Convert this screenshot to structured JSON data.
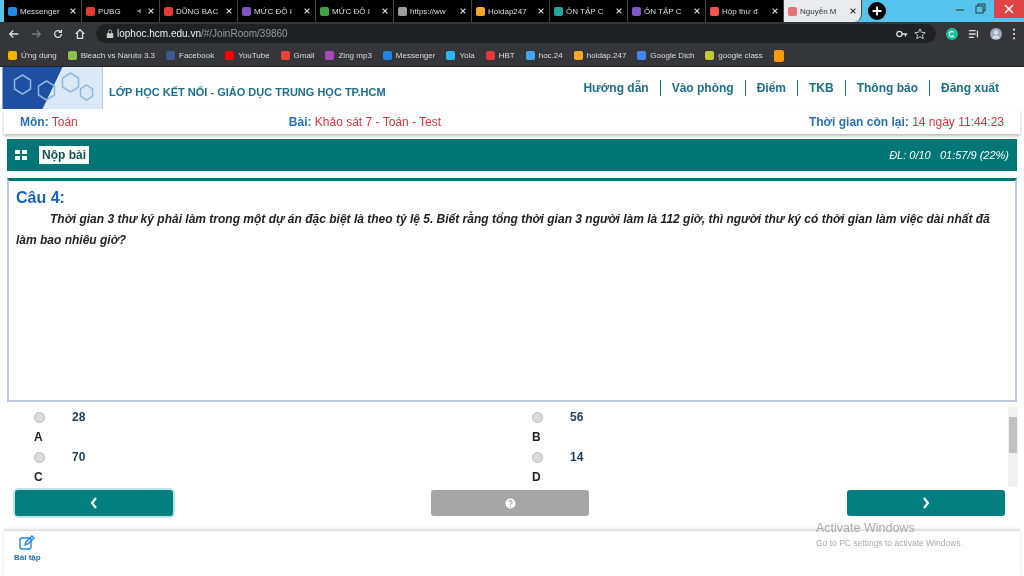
{
  "browser": {
    "tabs": [
      {
        "label": "Messenger",
        "color": "#1e88e5",
        "selected": false,
        "audio": false
      },
      {
        "label": "PUBG",
        "color": "#e53935",
        "selected": false,
        "audio": true
      },
      {
        "label": "DŨNG BAC",
        "color": "#e53935",
        "selected": false,
        "audio": false
      },
      {
        "label": "MỨC ĐỘ I",
        "color": "#7e57c2",
        "selected": false,
        "audio": false
      },
      {
        "label": "MỨC ĐỘ I",
        "color": "#43a047",
        "selected": false,
        "audio": false
      },
      {
        "label": "https://ww",
        "color": "#9e9e9e",
        "selected": false,
        "audio": false
      },
      {
        "label": "Hoidap247",
        "color": "#f9a825",
        "selected": false,
        "audio": false
      },
      {
        "label": "ÔN TẬP C",
        "color": "#26a69a",
        "selected": false,
        "audio": false
      },
      {
        "label": "ÔN TẬP C",
        "color": "#7e57c2",
        "selected": false,
        "audio": false
      },
      {
        "label": "Hộp thư đ",
        "color": "#ef5350",
        "selected": false,
        "audio": false
      },
      {
        "label": "Nguyễn M",
        "color": "#e57373",
        "selected": true,
        "audio": false
      }
    ],
    "url_host": "lophoc.hcm.edu.vn",
    "url_path": "/#/JoinRoom/39860",
    "bookmarks": [
      {
        "label": "Ứng dụng",
        "color": "#f4b400"
      },
      {
        "label": "Bleach vs Naruto 3.3",
        "color": "#8bc34a"
      },
      {
        "label": "Facebook",
        "color": "#3b5998"
      },
      {
        "label": "YouTube",
        "color": "#ff0000"
      },
      {
        "label": "Gmail",
        "color": "#ea4335"
      },
      {
        "label": "Zing mp3",
        "color": "#ab47bc"
      },
      {
        "label": "Messenger",
        "color": "#1e88e5"
      },
      {
        "label": "Yola",
        "color": "#29b6f6"
      },
      {
        "label": "HBT",
        "color": "#e53935"
      },
      {
        "label": "hoc.24",
        "color": "#42a5f5"
      },
      {
        "label": "hoidap.247",
        "color": "#f9a825"
      },
      {
        "label": "Google Dịch",
        "color": "#4285f4"
      },
      {
        "label": "google class",
        "color": "#c0ca33"
      },
      {
        "color": "#ff9800"
      }
    ]
  },
  "site": {
    "title": "LỚP HỌC KẾT NỐI -  GIÁO DỤC TRUNG HỌC TP.HCM",
    "nav": [
      "Hướng dẫn",
      "Vào phòng",
      "Điểm",
      "TKB",
      "Thông báo",
      "Đăng xuất"
    ]
  },
  "info": {
    "subject_label": "Môn:",
    "subject": "Toán",
    "lesson_label": "Bài:",
    "lesson": "Khảo sát 7 - Toán - Test",
    "time_label": "Thời gian còn lại:",
    "time": "14 ngày 11:44:23"
  },
  "toolbar": {
    "submit": "Nộp bài",
    "progress": "ĐL: 0/10   01:57/9 (22%)"
  },
  "question": {
    "title": "Câu 4:",
    "text": "Thời gian 3 thư ký phải làm trong một dự án đặc biệt là theo tỷ lệ 5. Biết rằng tổng thời gian 3 người làm là 112 giờ, thì người thư ký có thời gian làm việc dài nhất đã làm bao nhiêu giờ?"
  },
  "options": [
    {
      "value": "28",
      "letter": "A",
      "selected": false
    },
    {
      "value": "56",
      "letter": "B",
      "selected": false
    },
    {
      "value": "70",
      "letter": "C",
      "selected": false
    },
    {
      "value": "14",
      "letter": "D",
      "selected": false
    }
  ],
  "bottom_nav": {
    "label": "Bài tập"
  },
  "os_notice": {
    "title": "Activate Windows",
    "text": "Go to PC settings to activate Windows."
  }
}
